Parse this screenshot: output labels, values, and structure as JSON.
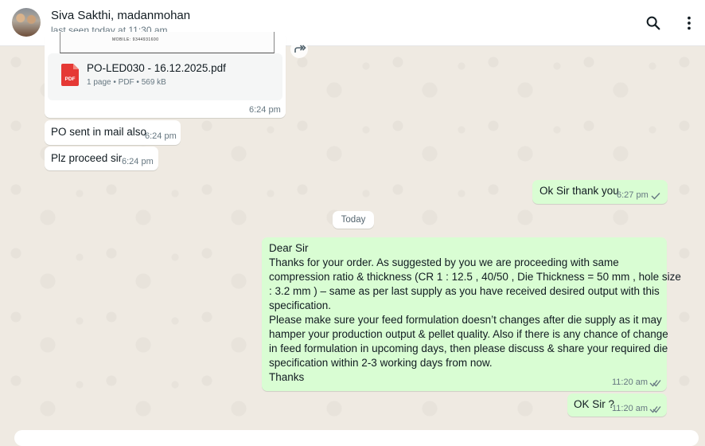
{
  "header": {
    "contact_name": "Siva Sakthi, madanmohan",
    "last_seen": "last seen today at 11:30 am"
  },
  "icons": {
    "search": "search-icon",
    "menu": "vertical-dots-icon",
    "forward": "forward-icon",
    "pdf": "pdf-file-icon",
    "tick_single": "single-tick-icon",
    "tick_double": "double-tick-icon"
  },
  "colors": {
    "incoming_bubble": "#ffffff",
    "outgoing_bubble": "#d9fdd3",
    "pdf_red": "#e53935",
    "wallpaper": "#efeae2"
  },
  "messages": [
    {
      "direction": "in",
      "type": "document",
      "preview_text": "MOBILE: 9344931600",
      "file_name": "PO-LED030 - 16.12.2025.pdf",
      "file_meta": "1 page • PDF • 569 kB",
      "file_badge": "PDF",
      "time": "6:24 pm"
    },
    {
      "direction": "in",
      "text": "PO sent in mail also",
      "time": "6:24 pm"
    },
    {
      "direction": "in",
      "text": "Plz proceed sir",
      "time": "6:24 pm"
    },
    {
      "direction": "out",
      "text": "Ok Sir thank you",
      "time": "6:27 pm",
      "status": "sent"
    },
    {
      "direction": "out",
      "lines": [
        "Dear Sir",
        "Thanks for your order. As suggested by you we are proceeding with same",
        "compression ratio & thickness (CR 1 : 12.5 , 40/50 , Die Thickness = 50 mm , hole size",
        ": 3.2 mm  ) – same as per last supply as you have received desired output with this",
        "specification.",
        "Please make sure your feed formulation doesn’t changes after die supply as it may",
        "hamper your production output & pellet quality. Also if there is any chance of change",
        "in feed formulation in upcoming days, then please discuss & share your required die",
        "specification within 2-3 working days from now.",
        "Thanks"
      ],
      "time": "11:20 am",
      "status": "delivered"
    },
    {
      "direction": "out",
      "text": "OK Sir ?",
      "time": "11:20 am",
      "status": "delivered"
    }
  ],
  "date_divider": "Today"
}
